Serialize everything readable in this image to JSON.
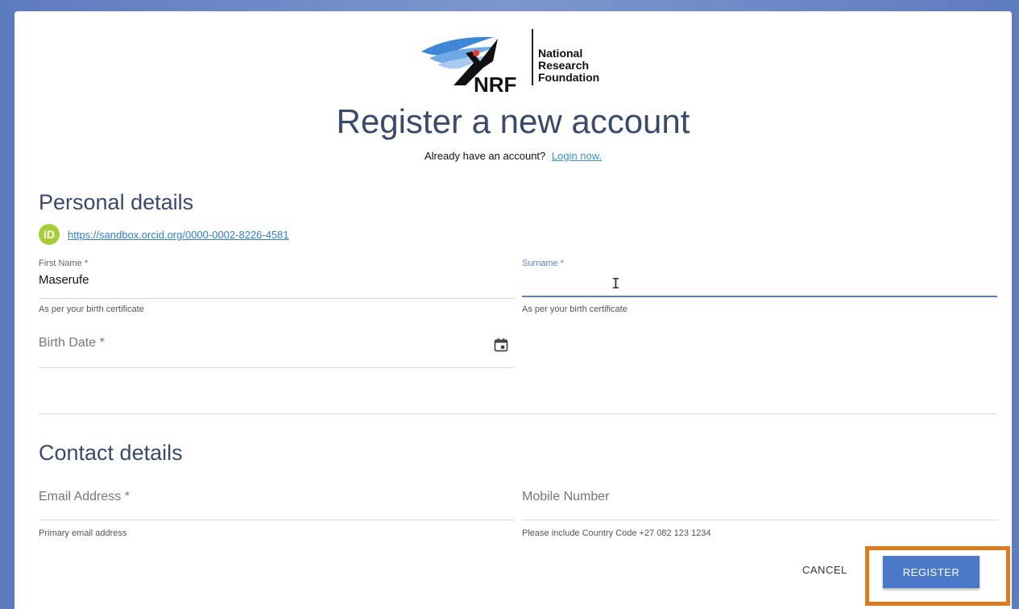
{
  "logo": {
    "line1": "National",
    "line2": "Research",
    "line3": "Foundation",
    "mark": "NRF"
  },
  "header": {
    "title": "Register a new account",
    "already_text": "Already have an account?",
    "login_link": "Login now."
  },
  "personal": {
    "section_title": "Personal details",
    "orcid_badge": "iD",
    "orcid_url": "https://sandbox.orcid.org/0000-0002-8226-4581",
    "first_name": {
      "label": "First Name *",
      "value": "Maserufe",
      "hint": "As per your birth certificate"
    },
    "surname": {
      "label": "Surname *",
      "value": "",
      "hint": "As per your birth certificate"
    },
    "birth_date": {
      "label": "Birth Date *"
    }
  },
  "contact": {
    "section_title": "Contact details",
    "email": {
      "label": "Email Address *",
      "hint": "Primary email address"
    },
    "mobile": {
      "label": "Mobile Number",
      "hint": "Please include Country Code +27 082 123 1234"
    }
  },
  "actions": {
    "cancel_label": "CANCEL",
    "register_label": "REGISTER"
  },
  "colors": {
    "accent": "#4c78c9",
    "highlight_border": "#e07a1f",
    "orcid_green": "#a6ce39",
    "title_text": "#3b4a6b"
  },
  "icons": {
    "orcid": "orcid-icon",
    "calendar": "calendar-icon",
    "text_cursor": "text-cursor-icon"
  }
}
